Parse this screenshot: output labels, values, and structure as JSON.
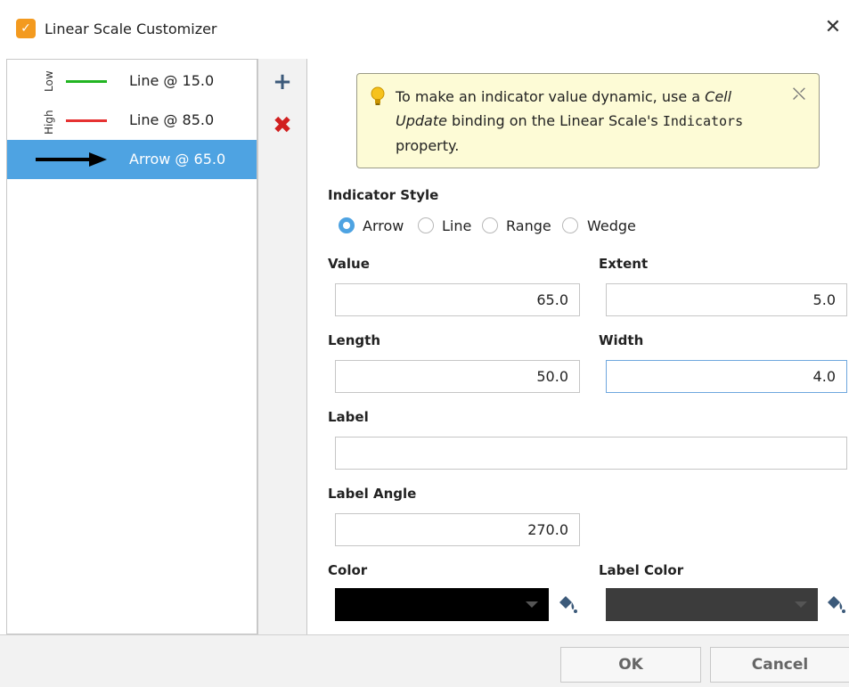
{
  "window": {
    "title": "Linear Scale Customizer",
    "close_glyph": "✕"
  },
  "indicator_list": {
    "side_labels": {
      "low": "Low",
      "high": "High"
    },
    "items": [
      {
        "label": "Line @ 15.0",
        "swatch": "line",
        "color": "#22b522"
      },
      {
        "label": "Line @ 85.0",
        "swatch": "line",
        "color": "#e63232"
      },
      {
        "label": "Arrow @ 65.0",
        "swatch": "arrow",
        "color": "#000000",
        "selected": true
      }
    ]
  },
  "toolbar": {
    "add_glyph": "+",
    "delete_glyph": "✖"
  },
  "info": {
    "text_1": "To make an indicator value dynamic, use a ",
    "text_em": "Cell Update",
    "text_2": " binding on the Linear Scale's ",
    "text_mono": "Indicators",
    "text_3": " property.",
    "dismiss_glyph": "⛌"
  },
  "form": {
    "indicator_style_label": "Indicator Style",
    "styles": [
      "Arrow",
      "Line",
      "Range",
      "Wedge"
    ],
    "selected_style": "Arrow",
    "value_label": "Value",
    "value": "65.0",
    "extent_label": "Extent",
    "extent": "5.0",
    "length_label": "Length",
    "length": "50.0",
    "width_label": "Width",
    "width": "4.0",
    "label_label": "Label",
    "label_value": "",
    "label_angle_label": "Label Angle",
    "label_angle": "270.0",
    "color_label": "Color",
    "color_value": "#000000",
    "label_color_label": "Label Color",
    "label_color_value": "#3c3c3c"
  },
  "footer": {
    "ok": "OK",
    "cancel": "Cancel"
  },
  "colors": {
    "accent": "#4ea3e2",
    "info_bg": "#fdfbd6",
    "app_icon": "#f39a1f"
  }
}
